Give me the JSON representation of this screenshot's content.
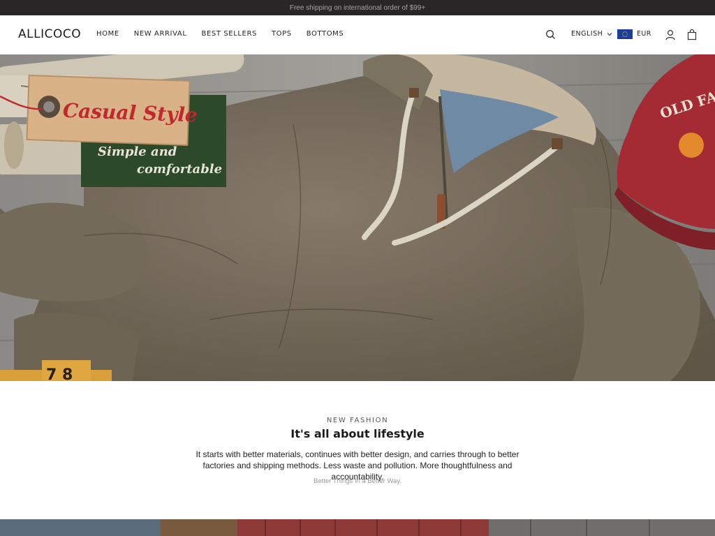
{
  "announcement": {
    "text": "Free shipping on international order of $99+"
  },
  "header": {
    "logo": "ALLICOCO",
    "nav": [
      {
        "label": "HOME"
      },
      {
        "label": "NEW ARRIVAL"
      },
      {
        "label": "BEST SELLERS"
      },
      {
        "label": "TOPS"
      },
      {
        "label": "BOTTOMS"
      }
    ],
    "language": "ENGLISH",
    "currency": "EUR",
    "icons": [
      "search-icon",
      "chevron-down-icon",
      "eu-flag-icon",
      "user-icon",
      "cart-icon"
    ]
  },
  "hero": {
    "tag_title": "Casual Style",
    "sign_line1": "Simple and",
    "sign_line2": "comfortable",
    "cap_text": "OLD FASHION",
    "ruler_text": "7 8"
  },
  "intro": {
    "eyebrow": "NEW FASHION",
    "headline": "It's all about lifestyle",
    "body": "It starts with better materials, continues with better design, and carries through to better factories and shipping methods. Less waste and pollution. More thoughtfulness and accountability.",
    "tagline": "Better Things In a Better Way."
  },
  "colors": {
    "announce_bg": "#2a2627",
    "flag_blue": "#1d3f99",
    "tag_red": "#c2272d",
    "sign_green": "#2c4a2a",
    "cap_red": "#a42a34"
  }
}
